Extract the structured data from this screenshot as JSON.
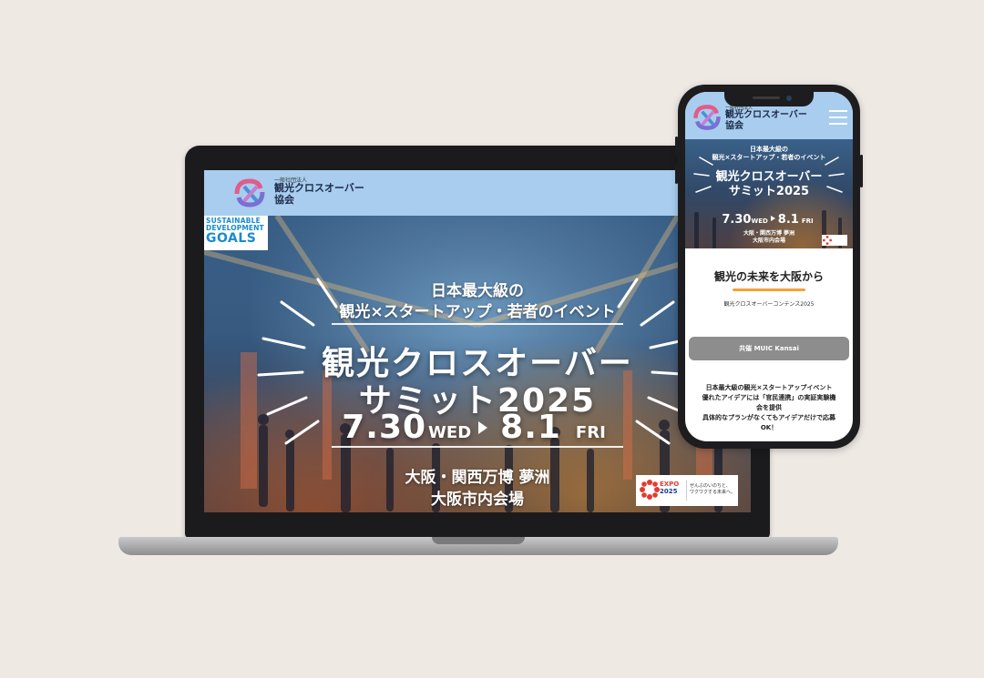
{
  "desktop": {
    "header": {
      "org_type": "一般社団法人",
      "org_name_line1": "観光クロスオーバー",
      "org_name_line2": "協会"
    },
    "sdg_badge": {
      "line1": "SUSTAINABLE",
      "line2": "DEVELOPMENT",
      "line3": "GOALS"
    },
    "hero": {
      "subtitle_line1": "日本最大級の",
      "subtitle_line2": "観光×スタートアップ・若者のイベント",
      "title_line1": "観光クロスオーバー",
      "title_line2": "サミット2025",
      "start_date": "7.30",
      "start_day": "WED",
      "end_date": "8.1",
      "end_day": "FRI",
      "venue_line1": "大阪・関西万博 夢洲",
      "venue_line2": "大阪市内会場"
    },
    "expo_badge": {
      "name": "EXPO",
      "year": "2025",
      "tagline_line1": "ぜんぶのいのちと、",
      "tagline_line2": "ワクワクする未来へ。"
    }
  },
  "mobile": {
    "header": {
      "org_type": "一般社団法人",
      "org_name_line1": "観光クロスオーバー",
      "org_name_line2": "協会",
      "menu_icon": "hamburger-icon"
    },
    "hero": {
      "subtitle_line1": "日本最大級の",
      "subtitle_line2": "観光×スタートアップ・若者のイベント",
      "title_line1": "観光クロスオーバー",
      "title_line2": "サミット2025",
      "start_date": "7.30",
      "start_day": "WED",
      "end_date": "8.1",
      "end_day": "FRI",
      "venue_line1": "大阪・関西万博 夢洲",
      "venue_line2": "大阪市内会場"
    },
    "section": {
      "title": "観光の未来を大阪から",
      "subtitle": "観光クロスオーバーコンテンス2025"
    },
    "sponsor_button": "共催 MUIC Kansai",
    "body_lines": [
      "日本最大級の観光×スタートアップイベント",
      "優れたアイデアには「官民連携」の実証実験機",
      "会を提供",
      "具体的なプランがなくてもアイデアだけで応募",
      "OK！"
    ]
  },
  "colors": {
    "background": "#efe9e4",
    "header_blue": "#a8cdee",
    "accent_orange": "#f3a33a",
    "sdg_blue": "#1a8ad1",
    "expo_red": "#e63a2e"
  }
}
